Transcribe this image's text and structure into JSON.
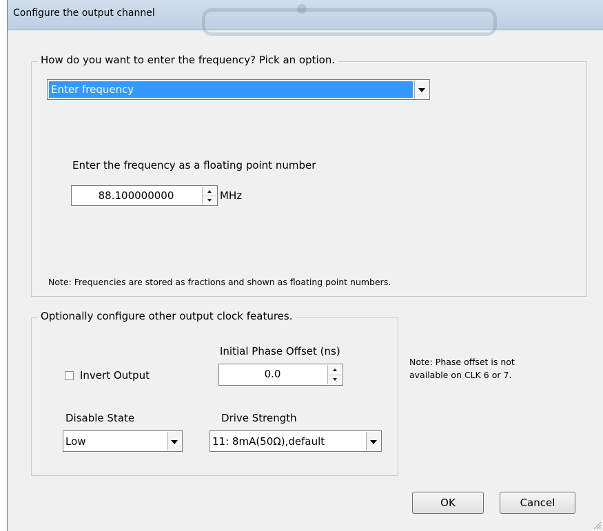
{
  "window": {
    "title": "Configure the output channel"
  },
  "frequency_group": {
    "legend": "How do you want to enter the frequency? Pick an option.",
    "mode_select_value": "Enter frequency",
    "prompt": "Enter the frequency as a floating point number",
    "frequency_value": "88.100000000",
    "unit": "MHz",
    "note": "Note: Frequencies are stored as fractions and shown as floating point numbers."
  },
  "features_group": {
    "legend": "Optionally configure other output clock features.",
    "invert_output_label": "Invert Output",
    "invert_output_checked": false,
    "phase_offset_label": "Initial Phase Offset (ns)",
    "phase_offset_value": "0.0",
    "disable_state_label": "Disable State",
    "disable_state_value": "Low",
    "drive_strength_label": "Drive Strength",
    "drive_strength_value": "11: 8mA(50Ω),default"
  },
  "phase_note": {
    "line1": "Note: Phase offset is not",
    "line2": "available on CLK 6 or 7."
  },
  "buttons": {
    "ok": "OK",
    "cancel": "Cancel"
  },
  "colors": {
    "selection": "#3399ff",
    "dialog_bg": "#f0f0f0",
    "titlebar": "#c4d6e8"
  }
}
